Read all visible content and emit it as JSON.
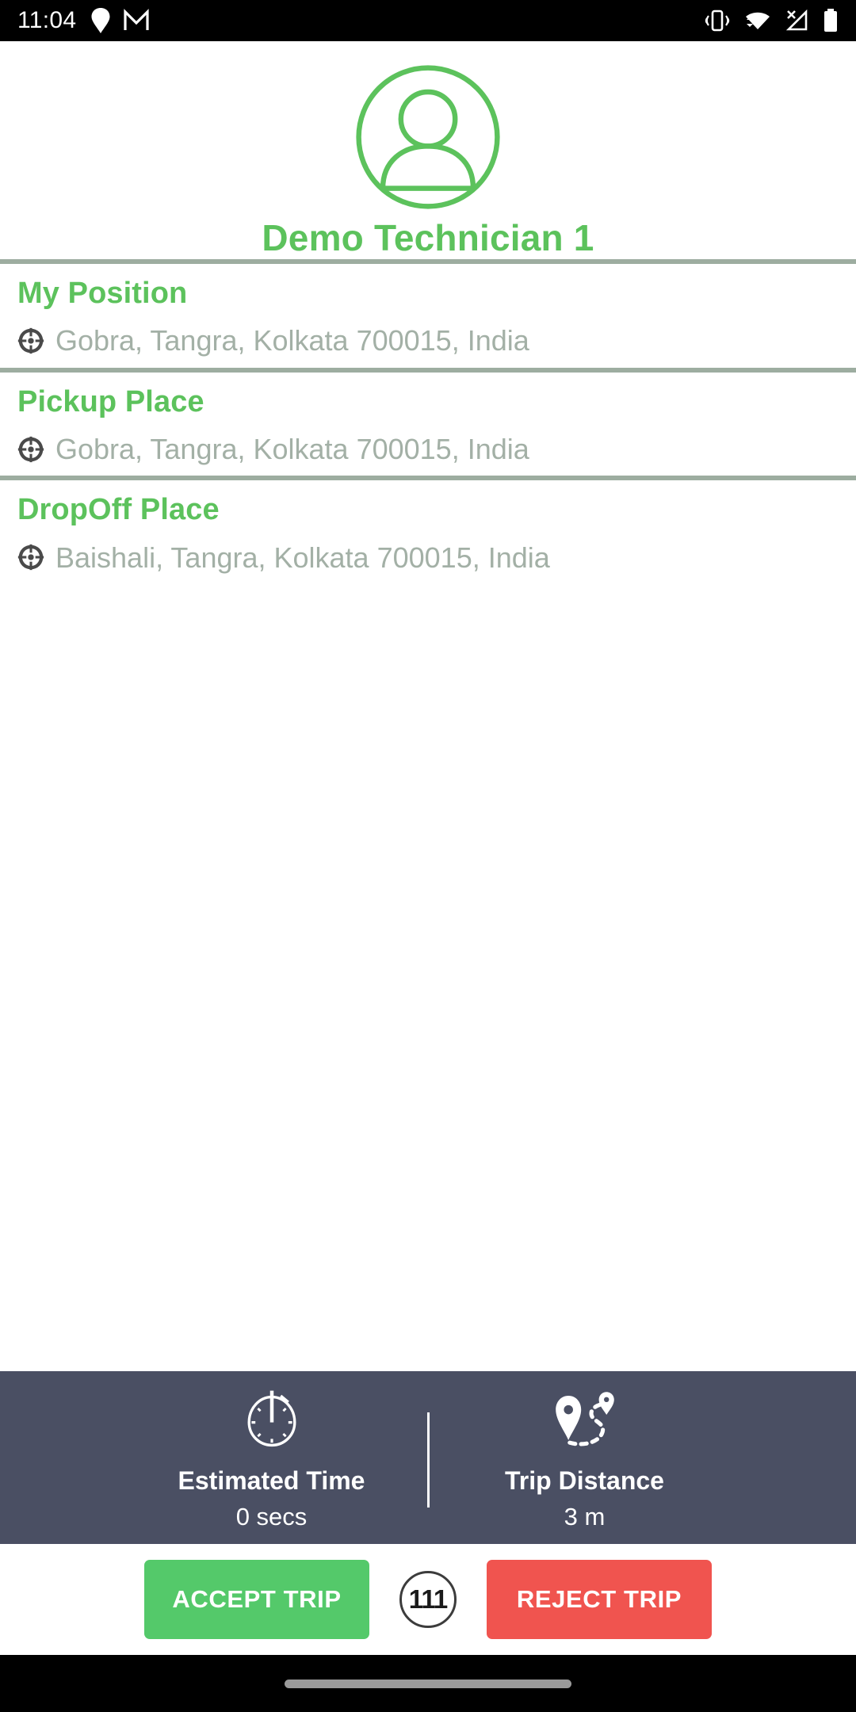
{
  "status_bar": {
    "clock": "11:04",
    "left_icons": [
      "location-pin-icon",
      "gmail-icon"
    ],
    "right_icons": [
      "vibrate-icon",
      "wifi-icon",
      "no-signal-icon",
      "battery-icon"
    ]
  },
  "profile": {
    "avatar_icon": "user-avatar-icon",
    "name": "Demo Technician 1",
    "accent_color": "#5cc25c"
  },
  "sections": [
    {
      "title": "My Position",
      "icon": "crosshair-icon",
      "address": "Gobra, Tangra, Kolkata 700015, India"
    },
    {
      "title": "Pickup Place",
      "icon": "crosshair-icon",
      "address": "Gobra, Tangra, Kolkata 700015, India"
    },
    {
      "title": "DropOff Place",
      "icon": "crosshair-icon",
      "address": "Baishali, Tangra, Kolkata 700015, India"
    }
  ],
  "stats": {
    "background_color": "#4a4f63",
    "items": [
      {
        "icon": "stopwatch-icon",
        "label": "Estimated Time",
        "value": "0 secs"
      },
      {
        "icon": "route-pin-icon",
        "label": "Trip Distance",
        "value": "3 m"
      }
    ]
  },
  "actions": {
    "accept_label": "ACCEPT TRIP",
    "accept_color": "#54c96a",
    "countdown": "111",
    "reject_label": "REJECT TRIP",
    "reject_color": "#f0544f"
  },
  "nav_bar": {
    "handle": "home-gesture-pill"
  }
}
